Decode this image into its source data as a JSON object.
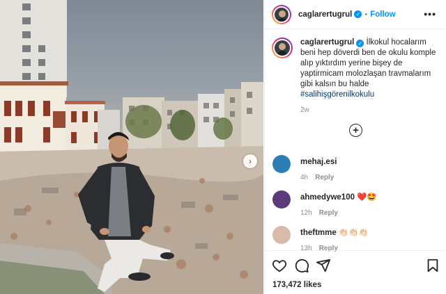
{
  "post": {
    "username": "caglarertugrul",
    "follow_label": "Follow",
    "separator": "•",
    "more_label": "•••",
    "caption_text": "İlkokul hocalarım beni hep döverdi ben de okulu komple alıp yıktırdım yerine bişey de yaptirmicam molozlaşan travmalarım gibi kalsın bu halde",
    "hashtag": "#salihişgörenilkokulu",
    "time_ago": "2w",
    "likes": "173,472 likes"
  },
  "comments": [
    {
      "username": "mehaj.esi",
      "text": "",
      "time": "4h",
      "reply_label": "Reply",
      "avatar_color": "#2b7fb5"
    },
    {
      "username": "ahmedywe100",
      "text": "❤️🤩",
      "time": "12h",
      "reply_label": "Reply",
      "avatar_color": "#5b3a7a"
    },
    {
      "username": "theftmme",
      "text": "👏🏻👏🏻👏🏻",
      "time": "13h",
      "reply_label": "Reply",
      "avatar_color": "#d9b9a8"
    }
  ],
  "icons": {
    "verified": "verified-badge-icon",
    "load_more": "plus-circle-icon",
    "like": "heart-icon",
    "comment": "comment-icon",
    "share": "paper-plane-icon",
    "save": "bookmark-icon",
    "next": "chevron-right-icon"
  },
  "colors": {
    "accent": "#0095f6",
    "hashtag": "#00376b",
    "meta": "#8e8e8e"
  }
}
